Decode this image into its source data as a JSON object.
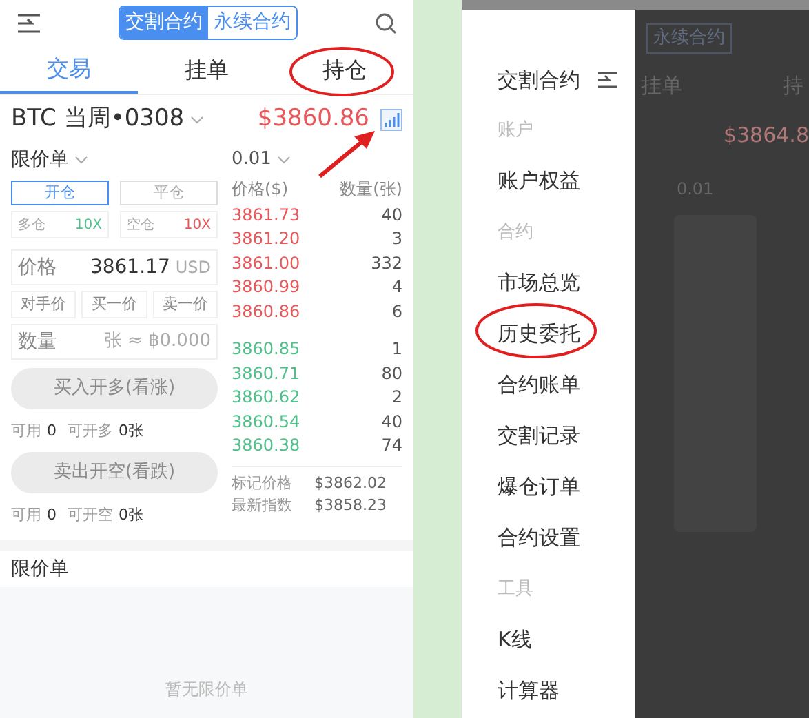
{
  "left_screen": {
    "segments": [
      {
        "label": "交割合约",
        "selected": true
      },
      {
        "label": "永续合约",
        "selected": false
      }
    ],
    "tabs": [
      {
        "label": "交易",
        "selected": true
      },
      {
        "label": "挂单",
        "selected": false
      },
      {
        "label": "持仓",
        "selected": false
      }
    ],
    "instrument": {
      "name": "BTC 当周•0308",
      "price": "$3860.86"
    },
    "order_type": "限价单",
    "precision": "0.01",
    "position_modes": [
      {
        "label": "开仓",
        "selected": true
      },
      {
        "label": "平仓",
        "selected": false
      }
    ],
    "leverage": [
      {
        "label": "多仓",
        "value": "10X",
        "kind": "long"
      },
      {
        "label": "空仓",
        "value": "10X",
        "kind": "short"
      }
    ],
    "price_field": {
      "label": "价格",
      "value": "3861.17",
      "unit": "USD"
    },
    "quick_prices": [
      "对手价",
      "买一价",
      "卖一价"
    ],
    "quantity_field": {
      "label": "数量",
      "placeholder": "张 ≈ ฿0.000"
    },
    "actions": [
      {
        "label": "买入开多(看涨)",
        "disabled": true,
        "available_label": "可用",
        "available": "0",
        "max_label": "可开多",
        "max": "0张"
      },
      {
        "label": "卖出开空(看跌)",
        "disabled": true,
        "available_label": "可用",
        "available": "0",
        "max_label": "可开空",
        "max": "0张"
      }
    ],
    "book": {
      "columns": [
        "价格($)",
        "数量(张)"
      ],
      "asks": [
        {
          "price": "3861.73",
          "qty": "40"
        },
        {
          "price": "3861.20",
          "qty": "3"
        },
        {
          "price": "3861.00",
          "qty": "332"
        },
        {
          "price": "3860.99",
          "qty": "4"
        },
        {
          "price": "3860.86",
          "qty": "6"
        }
      ],
      "bids": [
        {
          "price": "3860.85",
          "qty": "1"
        },
        {
          "price": "3860.71",
          "qty": "80"
        },
        {
          "price": "3860.62",
          "qty": "2"
        },
        {
          "price": "3860.54",
          "qty": "40"
        },
        {
          "price": "3860.38",
          "qty": "74"
        }
      ],
      "stats": [
        {
          "label": "标记价格",
          "value": "$3862.02"
        },
        {
          "label": "最新指数",
          "value": "$3858.23"
        }
      ]
    },
    "orders": {
      "title": "限价单",
      "empty": "暂无限价单"
    }
  },
  "right_screen": {
    "drawer": {
      "title": "交割合约",
      "sections": [
        {
          "header": "账户",
          "items": [
            "账户权益"
          ]
        },
        {
          "header": "合约",
          "items": [
            "市场总览",
            "历史委托",
            "合约账单",
            "交割记录",
            "爆仓订单",
            "合约设置"
          ]
        },
        {
          "header": "工具",
          "items": [
            "K线",
            "计算器"
          ]
        }
      ]
    },
    "dimmed": {
      "segment": "永续合约",
      "tab": "挂单",
      "tab_partial": "持",
      "price": "$3864.8",
      "precision": "0.01"
    }
  }
}
